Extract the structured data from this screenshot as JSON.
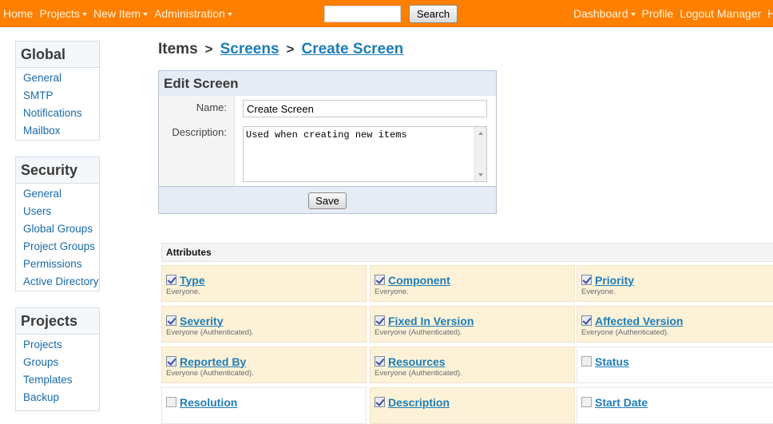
{
  "nav": {
    "left": [
      {
        "label": "Home",
        "dropdown": false
      },
      {
        "label": "Projects",
        "dropdown": true
      },
      {
        "label": "New Item",
        "dropdown": true
      },
      {
        "label": "Administration",
        "dropdown": true
      }
    ],
    "search": {
      "value": "",
      "placeholder": "",
      "button": "Search"
    },
    "right": [
      {
        "label": "Dashboard",
        "dropdown": true
      },
      {
        "label": "Profile",
        "dropdown": false
      },
      {
        "label": "Logout Manager",
        "dropdown": false
      },
      {
        "label": "Help",
        "dropdown": false
      }
    ],
    "colors": {
      "bar": "#ff7f00",
      "link": "#fff3dc"
    }
  },
  "sidebar": {
    "global": {
      "title": "Global",
      "items": [
        "General",
        "SMTP",
        "Notifications",
        "Mailbox"
      ]
    },
    "security": {
      "title": "Security",
      "items": [
        "General",
        "Users",
        "Global Groups",
        "Project Groups",
        "Permissions",
        "Active Directory"
      ]
    },
    "projects": {
      "title": "Projects",
      "items": [
        "Projects",
        "Groups",
        "Templates",
        "Backup"
      ]
    }
  },
  "breadcrumb": {
    "root": "Items",
    "separator": ">",
    "screens": "Screens",
    "current": "Create Screen"
  },
  "edit_screen": {
    "title": "Edit Screen",
    "name_label": "Name:",
    "name_value": "Create Screen",
    "description_label": "Description:",
    "description_value": "Used when creating new items",
    "save_label": "Save"
  },
  "attributes": {
    "header": "Attributes",
    "items": [
      {
        "name": "Type",
        "checked": true,
        "access": "Everyone."
      },
      {
        "name": "Component",
        "checked": true,
        "access": "Everyone."
      },
      {
        "name": "Priority",
        "checked": true,
        "access": "Everyone."
      },
      {
        "name": "Severity",
        "checked": true,
        "access": "Everyone (Authenticated)."
      },
      {
        "name": "Fixed In Version",
        "checked": true,
        "access": "Everyone (Authenticated)."
      },
      {
        "name": "Affected Version",
        "checked": true,
        "access": "Everyone (Authenticated)."
      },
      {
        "name": "Reported By",
        "checked": true,
        "access": "Everyone (Authenticated)."
      },
      {
        "name": "Resources",
        "checked": true,
        "access": "Everyone (Authenticated)."
      },
      {
        "name": "Status",
        "checked": false,
        "access": ""
      },
      {
        "name": "Resolution",
        "checked": false,
        "access": ""
      },
      {
        "name": "Description",
        "checked": true,
        "access": ""
      },
      {
        "name": "Start Date",
        "checked": false,
        "access": ""
      }
    ]
  }
}
